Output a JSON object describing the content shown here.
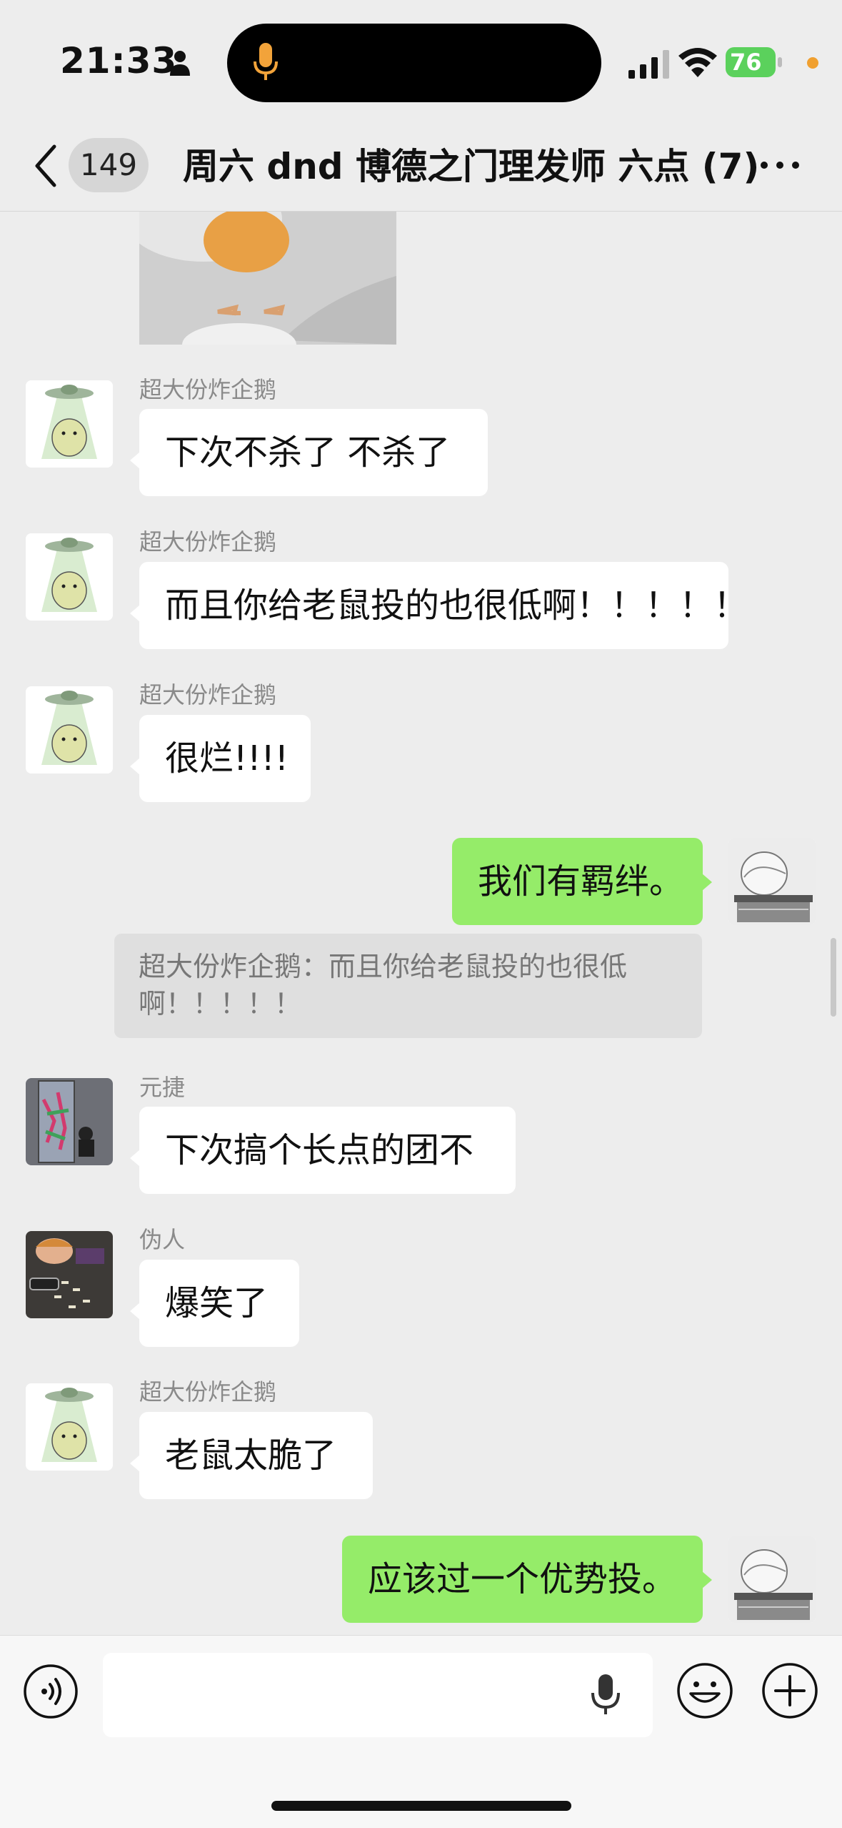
{
  "status_bar": {
    "time": "21:33",
    "battery": "76"
  },
  "nav": {
    "unread_count": "149",
    "title": "周六 dnd 博德之门理发师 六点 (7)"
  },
  "messages": [
    {
      "sender": "超大份炸企鹅",
      "text": "下次不杀了 不杀了"
    },
    {
      "sender": "超大份炸企鹅",
      "text": "而且你给老鼠投的也很低啊！！！！！"
    },
    {
      "sender": "超大份炸企鹅",
      "text": "很烂!!!!"
    },
    {
      "sender": "",
      "text": "我们有羁绊。"
    },
    {
      "quote": "超大份炸企鹅：而且你给老鼠投的也很低啊！！！！！"
    },
    {
      "sender": "元捷",
      "text": "下次搞个长点的团不"
    },
    {
      "sender": "伪人",
      "text": "爆笑了"
    },
    {
      "sender": "超大份炸企鹅",
      "text": "老鼠太脆了"
    },
    {
      "sender": "",
      "text": "应该过一个优势投。"
    }
  ],
  "input": {
    "placeholder": ""
  },
  "colors": {
    "background": "#ededed",
    "outgoing_bubble": "#95ec69",
    "incoming_bubble": "#ffffff",
    "battery": "#5bd15c"
  }
}
